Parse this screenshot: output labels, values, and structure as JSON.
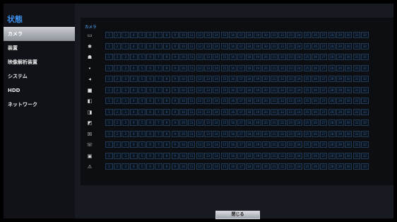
{
  "sidebar": {
    "title": "状態",
    "items": [
      {
        "label": "カメラ",
        "active": true
      },
      {
        "label": "装置",
        "active": false
      },
      {
        "label": "映像解析装置",
        "active": false
      },
      {
        "label": "システム",
        "active": false
      },
      {
        "label": "HDD",
        "active": false
      },
      {
        "label": "ネットワーク",
        "active": false
      }
    ]
  },
  "main": {
    "panel_label": "カメラ",
    "rows": [
      {
        "icon": "camera-icon",
        "glyph": "▭"
      },
      {
        "icon": "motion-icon",
        "glyph": "✱"
      },
      {
        "icon": "running-person-icon",
        "glyph": "☗"
      },
      {
        "icon": "dots-icon",
        "glyph": "•"
      },
      {
        "icon": "speaker-icon",
        "glyph": "◂"
      },
      {
        "icon": "alarm-icon",
        "glyph": "■"
      },
      {
        "icon": "record-icon",
        "glyph": "◧"
      },
      {
        "icon": "sensor-icon",
        "glyph": "◨"
      },
      {
        "icon": "folder-icon",
        "glyph": "◩"
      },
      {
        "icon": "blocked-person-icon",
        "glyph": "☒"
      },
      {
        "icon": "phone-icon",
        "glyph": "☏"
      },
      {
        "icon": "lock-icon",
        "glyph": "▣"
      },
      {
        "icon": "alert-person-icon",
        "glyph": "⚠"
      }
    ],
    "channels": [
      "1",
      "2",
      "3",
      "4",
      "5",
      "6",
      "7",
      "8",
      "9",
      "10",
      "11",
      "12",
      "13",
      "14",
      "15",
      "16",
      "17",
      "18",
      "19",
      "20",
      "21",
      "22",
      "23",
      "24",
      "25",
      "26",
      "27",
      "28",
      "29",
      "30",
      "31",
      "32"
    ]
  },
  "footer": {
    "close_label": "閉じる"
  }
}
